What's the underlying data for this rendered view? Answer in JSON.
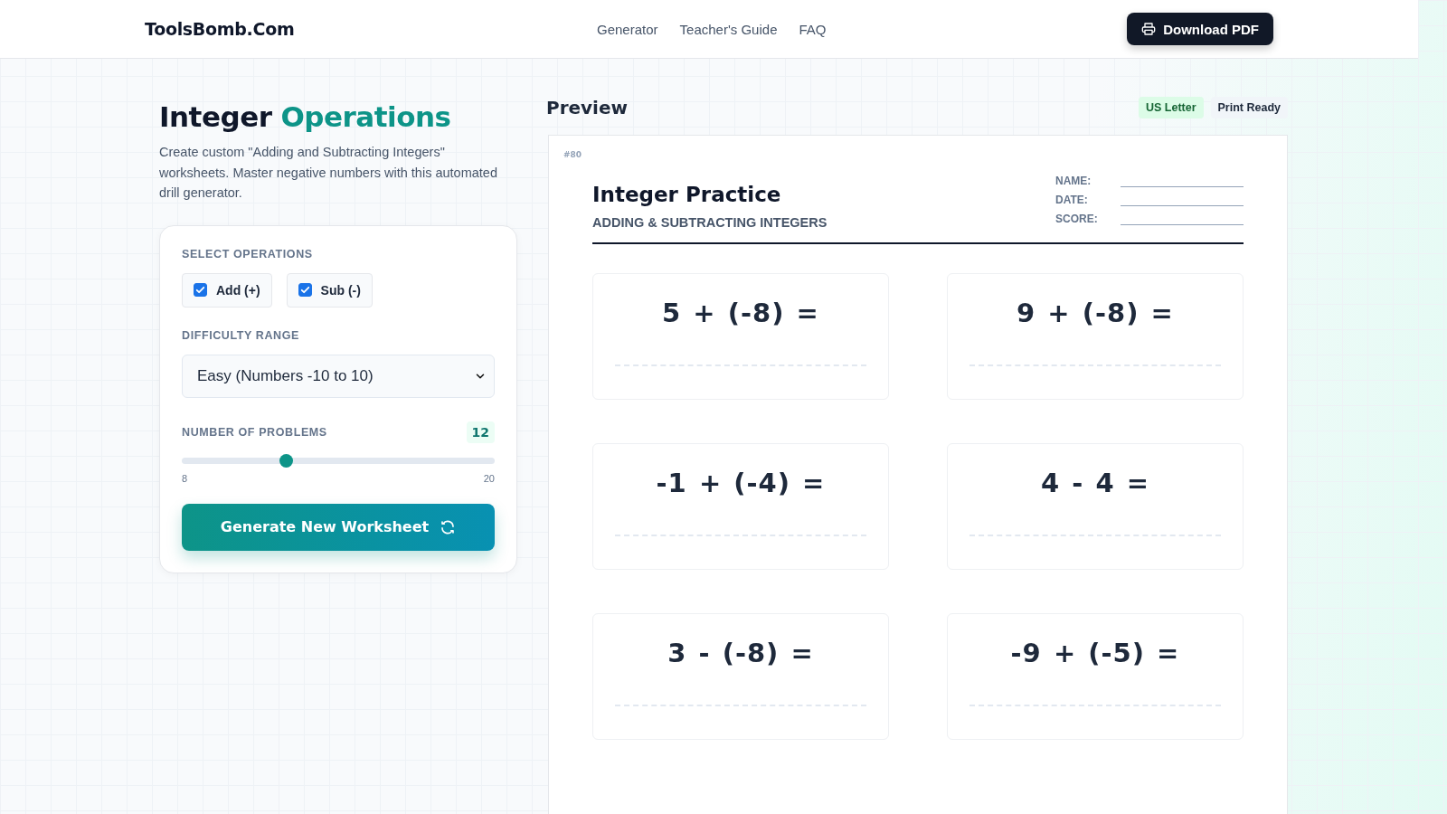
{
  "header": {
    "logo": "ToolsBomb.Com",
    "nav": [
      {
        "label": "Generator"
      },
      {
        "label": "Teacher's Guide"
      },
      {
        "label": "FAQ"
      }
    ],
    "download_button": "Download PDF"
  },
  "intro": {
    "title_plain": "Integer",
    "title_accent": "Operations",
    "description": "Create custom \"Adding and Subtracting Integers\" worksheets. Master negative numbers with this automated drill generator."
  },
  "settings": {
    "operations_label": "SELECT OPERATIONS",
    "operations": [
      {
        "label": "Add (+)",
        "checked": true
      },
      {
        "label": "Sub (-)",
        "checked": true
      }
    ],
    "difficulty_label": "DIFFICULTY RANGE",
    "difficulty_value": "Easy (Numbers -10 to 10)",
    "problems_label": "NUMBER OF PROBLEMS",
    "problems_value": "12",
    "problems_slider": {
      "level": 0.333,
      "min": "8",
      "max": "20"
    },
    "generate_button": "Generate New Worksheet"
  },
  "preview": {
    "title": "Preview",
    "badges": [
      {
        "label": "US Letter",
        "kind": "paper"
      },
      {
        "label": "Print Ready",
        "kind": "status"
      }
    ],
    "worksheet": {
      "tag": "#80",
      "title": "Integer Practice",
      "subtitle": "ADDING & SUBTRACTING INTEGERS",
      "fields": [
        {
          "label": "NAME:"
        },
        {
          "label": "DATE:"
        },
        {
          "label": "SCORE:"
        }
      ],
      "problems": [
        {
          "equation": "5 + (-8) ="
        },
        {
          "equation": "9 + (-8) ="
        },
        {
          "equation": "-1 + (-4) ="
        },
        {
          "equation": "4 - 4 ="
        },
        {
          "equation": "3 - (-8) ="
        },
        {
          "equation": "-9 + (-5) ="
        }
      ]
    }
  }
}
